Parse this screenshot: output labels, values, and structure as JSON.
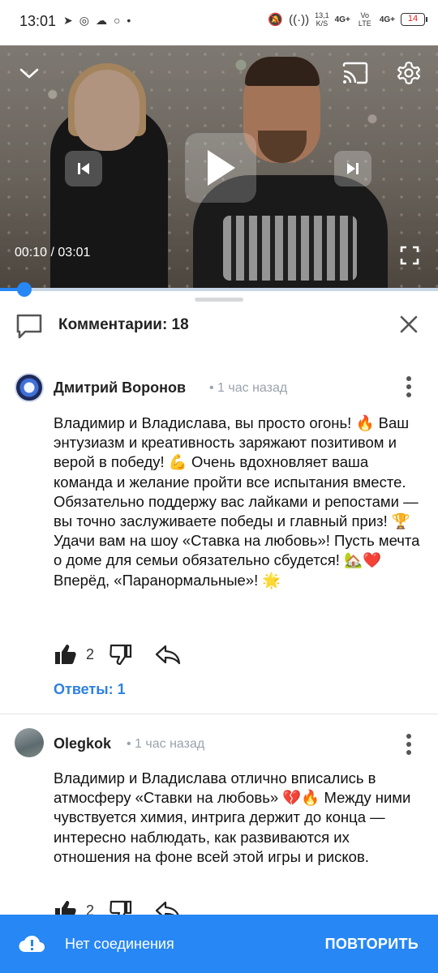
{
  "status_bar": {
    "time": "13:01",
    "net_speed": "13,1",
    "net_speed_unit": "K/S",
    "network_1": "4G+",
    "network_2": "Vo LTE",
    "network_3": "4G+",
    "battery": "14"
  },
  "player": {
    "time_current": "00:10",
    "time_separator": " / ",
    "time_total": "03:01",
    "progress_fraction": 0.055
  },
  "comments_panel": {
    "title": "Комментарии: 18"
  },
  "comments": [
    {
      "author": "Дмитрий Воронов",
      "time": "• 1 час назад",
      "text": "Владимир и Владислава, вы просто огонь! 🔥 Ваш энтузиазм и креативность заряжают позитивом и верой в победу! 💪 Очень вдохновляет ваша команда и желание пройти все испытания вместе. Обязательно поддержу вас лайками и репостами — вы точно заслуживаете победы и главный приз! 🏆 Удачи вам на шоу «Ставка на любовь»! Пусть мечта о доме для семьи обязательно сбудется! 🏡❤️ Вперёд, «Паранормальные»! 🌟",
      "likes": "2",
      "replies": "Ответы: 1"
    },
    {
      "author": "Olegkok",
      "time": "• 1 час назад",
      "text": "Владимир и Владислава отлично вписались в атмосферу «Ставки на любовь» 💔🔥 Между ними чувствуется химия, интрига держит до конца — интересно наблюдать, как развиваются их отношения на фоне всей этой игры и рисков.",
      "likes": "2"
    }
  ],
  "network_bar": {
    "message": "Нет соединения",
    "retry_label": "ПОВТОРИТЬ"
  },
  "colors": {
    "accent": "#2787f5",
    "link": "#2d81e0",
    "secondary_text": "#99a2ad"
  }
}
